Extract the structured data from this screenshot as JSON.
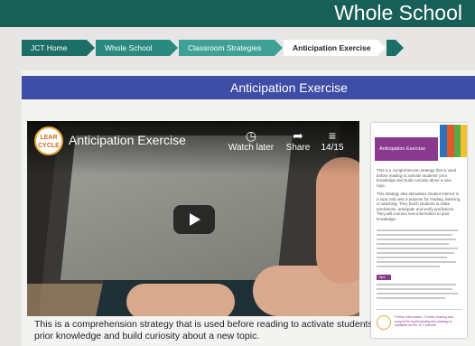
{
  "header": {
    "title": "Whole School"
  },
  "breadcrumb": [
    {
      "label": "JCT Home"
    },
    {
      "label": "Whole School"
    },
    {
      "label": "Classroom Strategies"
    },
    {
      "label": "Anticipation Exercise"
    }
  ],
  "panel": {
    "title": "Anticipation Exercise"
  },
  "video": {
    "logo_text": "LEAR CYCLE",
    "title": "Anticipation Exercise",
    "watch_later_label": "Watch later",
    "share_label": "Share",
    "playlist_position": "14/15",
    "icons": {
      "watch_later": "clock-icon",
      "share": "share-arrow-icon",
      "playlist": "playlist-icon",
      "play": "play-icon"
    }
  },
  "description": "This is a comprehension strategy that is used before reading to activate students' prior knowledge and build curiosity about a new topic.",
  "document": {
    "heading": "Anticipation Exercise",
    "para1": "This is a comprehension strategy that is used before reading to activate students' prior knowledge and build curiosity about a new topic.",
    "para2": "This strategy also stimulates student interest in a topic and sets a purpose for reading, listening or watching. They teach students to make predictions, anticipate and verify predictions. They will connect new information to prior knowledge.",
    "tips_label": "Tips",
    "footer_text": "Further information / Further reading and support for implementing this strategy is available on the JCT website"
  },
  "colors": {
    "header": "#175f57",
    "panel_bar": "#3e4da6",
    "doc_accent": "#8a3a8e"
  }
}
